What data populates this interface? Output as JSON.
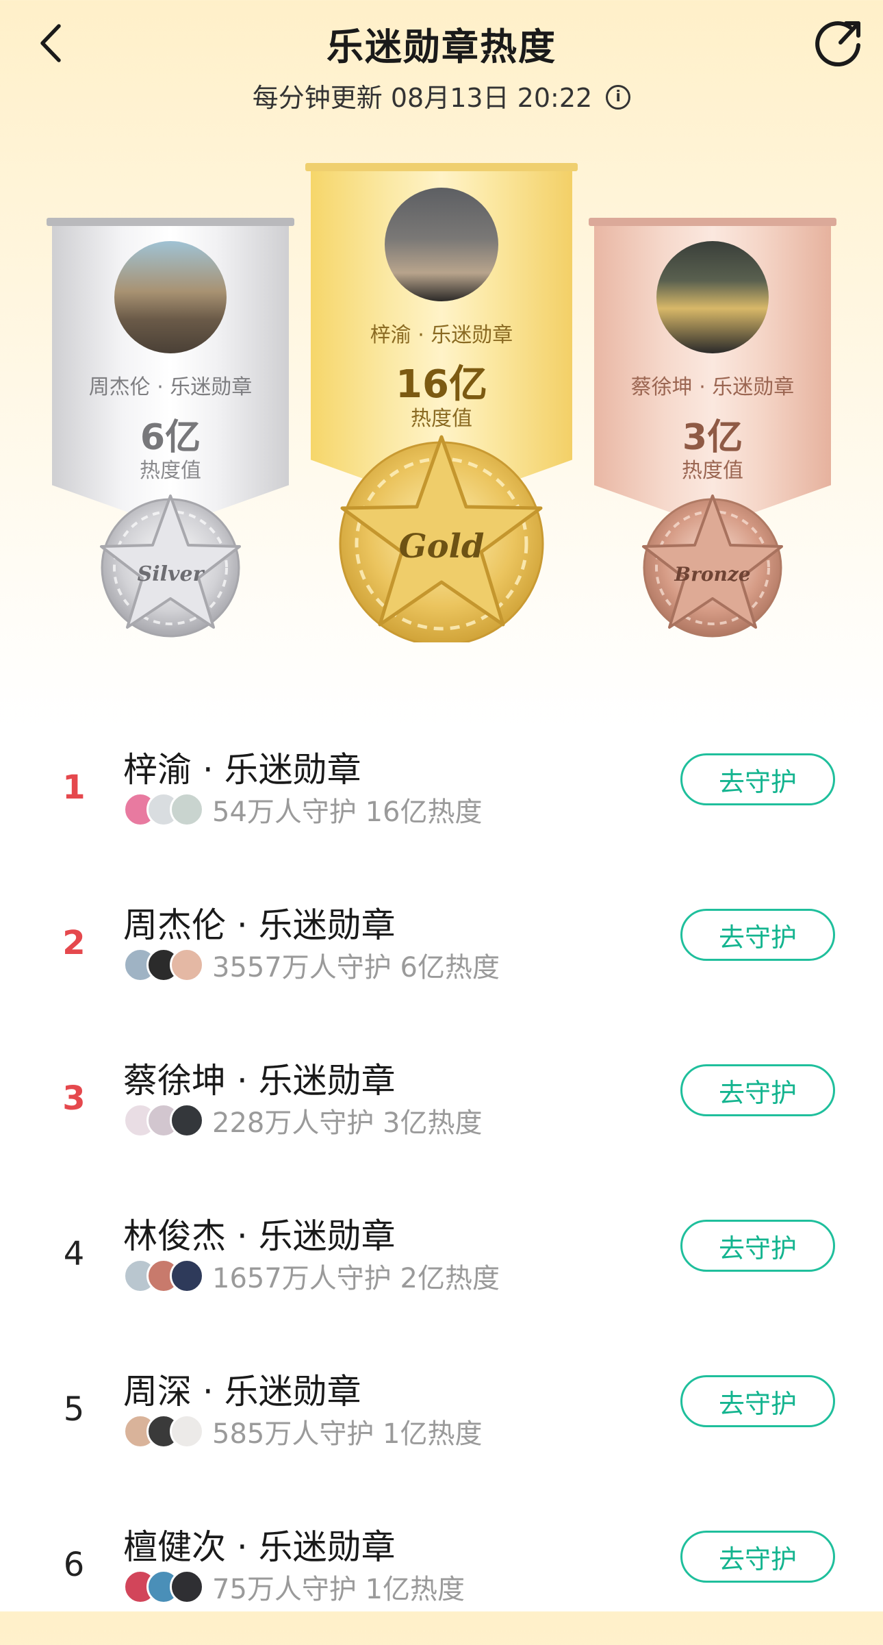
{
  "header": {
    "title": "乐迷勋章热度",
    "update_text": "每分钟更新 08月13日 20:22",
    "info_icon": "info-icon",
    "back_icon": "chevron-left-icon",
    "share_icon": "share-arrow-icon"
  },
  "podium": [
    {
      "name": "周杰伦 · 乐迷勋章",
      "value": "6亿",
      "label": "热度值",
      "medal": "Silver"
    },
    {
      "name": "梓渝 · 乐迷勋章",
      "value": "16亿",
      "label": "热度值",
      "medal": "Gold"
    },
    {
      "name": "蔡徐坤 · 乐迷勋章",
      "value": "3亿",
      "label": "热度值",
      "medal": "Bronze"
    }
  ],
  "ranking": [
    {
      "rank": "1",
      "name": "梓渝 · 乐迷勋章",
      "stats": "54万人守护  16亿热度",
      "button": "去守护"
    },
    {
      "rank": "2",
      "name": "周杰伦 · 乐迷勋章",
      "stats": "3557万人守护  6亿热度",
      "button": "去守护"
    },
    {
      "rank": "3",
      "name": "蔡徐坤 · 乐迷勋章",
      "stats": "228万人守护  3亿热度",
      "button": "去守护"
    },
    {
      "rank": "4",
      "name": "林俊杰 · 乐迷勋章",
      "stats": "1657万人守护  2亿热度",
      "button": "去守护"
    },
    {
      "rank": "5",
      "name": "周深 · 乐迷勋章",
      "stats": "585万人守护  1亿热度",
      "button": "去守护"
    },
    {
      "rank": "6",
      "name": "檀健次 · 乐迷勋章",
      "stats": "75万人守护  1亿热度",
      "button": "去守护"
    }
  ],
  "colors": {
    "accent": "#1fbf9c",
    "rank_top": "#e5484d",
    "gold": "#f2c94c",
    "silver": "#c9c9cc",
    "bronze": "#d9a08a"
  }
}
